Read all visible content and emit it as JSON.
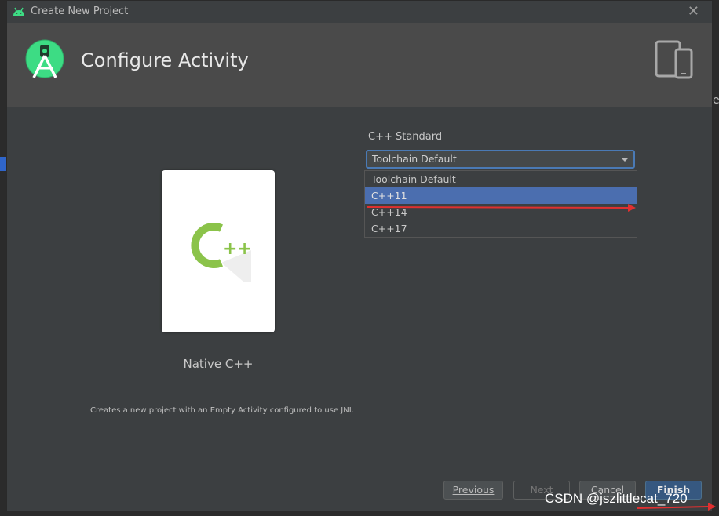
{
  "window": {
    "title": "Create New Project",
    "close_glyph": "✕"
  },
  "header": {
    "title": "Configure Activity",
    "logo_icon": "android-studio-icon",
    "devices_icon": "devices-icon"
  },
  "template": {
    "card_label": "Native C++",
    "description": "Creates a new project with an Empty Activity configured to use JNI."
  },
  "cpp_standard": {
    "label": "C++ Standard",
    "selected_value": "Toolchain Default",
    "options": [
      "Toolchain Default",
      "C++11",
      "C++14",
      "C++17"
    ],
    "highlighted_option": "C++11"
  },
  "footer": {
    "previous": "Previous",
    "next": "Next",
    "cancel": "Cancel",
    "finish": "Finish"
  },
  "watermark": "CSDN @jszlittlecat_720",
  "colors": {
    "accent": "#4b6eaf",
    "annotation_arrow": "#e03030",
    "logo_green": "#3ddc84",
    "cpp_green": "#8bc34a"
  }
}
